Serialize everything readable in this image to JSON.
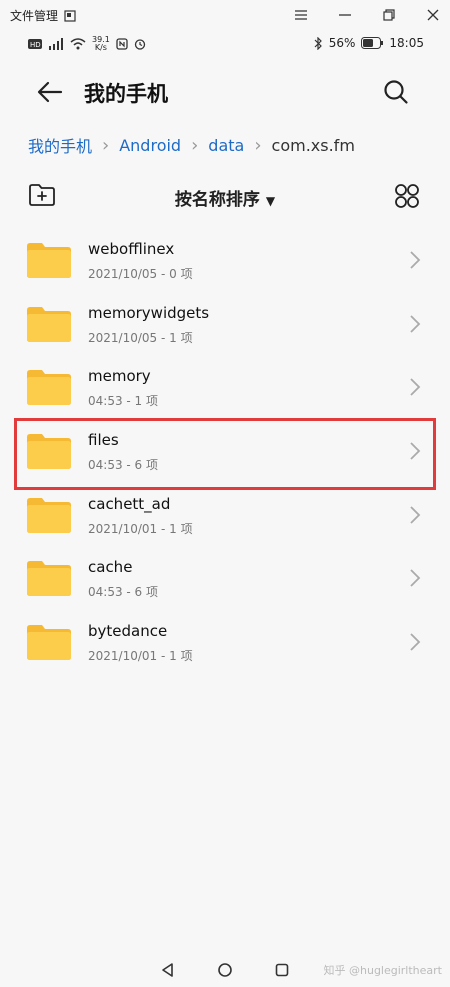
{
  "window": {
    "title": "文件管理"
  },
  "status": {
    "speed": "39.1",
    "speed_unit": "K/s",
    "battery": "56%",
    "time": "18:05"
  },
  "header": {
    "title": "我的手机"
  },
  "breadcrumb": [
    "我的手机",
    "Android",
    "data",
    "com.xs.fm"
  ],
  "toolbar": {
    "sort_label": "按名称排序"
  },
  "folders": [
    {
      "name": "webofflinex",
      "meta": "2021/10/05 - 0 项"
    },
    {
      "name": "memorywidgets",
      "meta": "2021/10/05 - 1 项"
    },
    {
      "name": "memory",
      "meta": "04:53 - 1 项"
    },
    {
      "name": "files",
      "meta": "04:53 - 6 项"
    },
    {
      "name": "cachett_ad",
      "meta": "2021/10/01 - 1 项"
    },
    {
      "name": "cache",
      "meta": "04:53 - 6 项"
    },
    {
      "name": "bytedance",
      "meta": "2021/10/01 - 1 项"
    }
  ],
  "watermark": "知乎 @huglegirltheart",
  "colors": {
    "accent": "#1e6bc7",
    "folder": "#fbc73d",
    "highlight": "#e23b3b"
  }
}
